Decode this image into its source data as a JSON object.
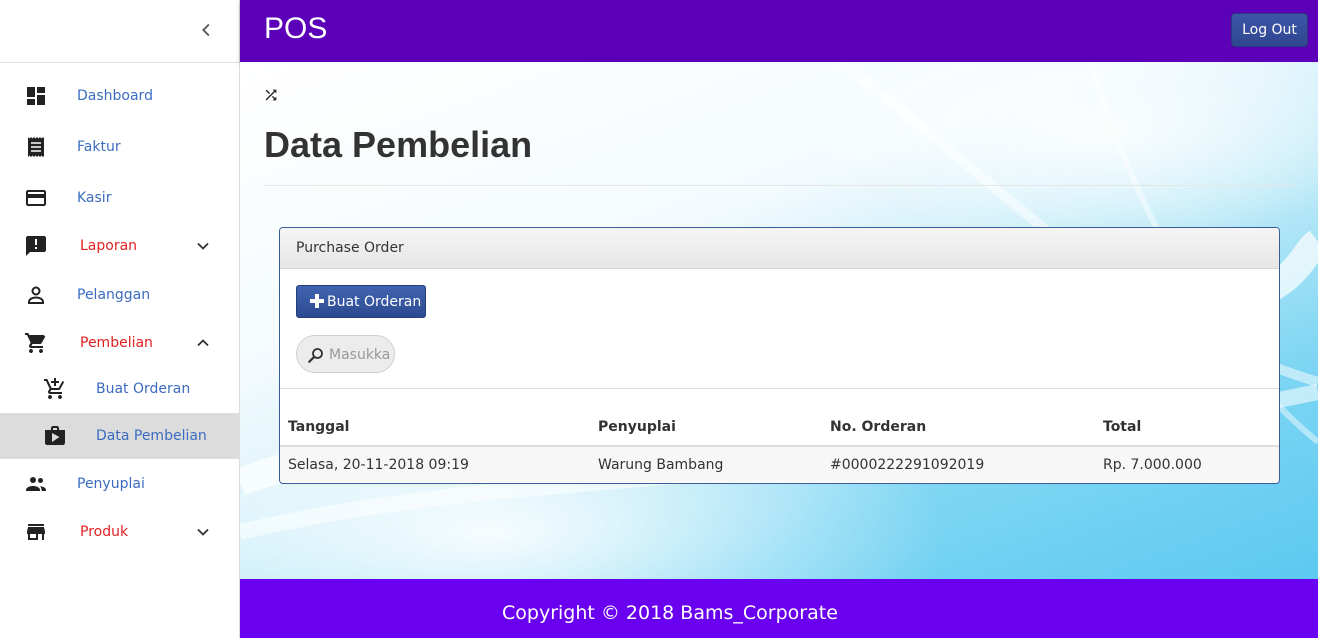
{
  "app": {
    "brand": "POS",
    "logout_label": "Log Out"
  },
  "sidebar": {
    "items": [
      {
        "label": "Dashboard",
        "icon": "dashboard-icon"
      },
      {
        "label": "Faktur",
        "icon": "receipt-icon"
      },
      {
        "label": "Kasir",
        "icon": "credit-card-icon"
      },
      {
        "label": "Laporan",
        "icon": "report-icon",
        "chevron": "expand"
      },
      {
        "label": "Pelanggan",
        "icon": "person-icon"
      },
      {
        "label": "Pembelian",
        "icon": "cart-icon",
        "chevron": "collapse"
      },
      {
        "label": "Buat Orderan",
        "icon": "add-cart-icon"
      },
      {
        "label": "Data Pembelian",
        "icon": "shop-icon",
        "active": true
      },
      {
        "label": "Penyuplai",
        "icon": "people-icon"
      },
      {
        "label": "Produk",
        "icon": "store-icon",
        "chevron": "expand"
      }
    ]
  },
  "page": {
    "title": "Data Pembelian"
  },
  "panel": {
    "heading": "Purchase Order",
    "create_button": "Buat Orderan",
    "search_placeholder": "Masukka"
  },
  "table": {
    "headers": [
      "Tanggal",
      "Penyuplai",
      "No. Orderan",
      "Total"
    ],
    "rows": [
      [
        "Selasa, 20-11-2018 09:19",
        "Warung Bambang",
        "#0000222291092019",
        "Rp. 7.000.000"
      ]
    ]
  },
  "footer": {
    "text": "Copyright © 2018 Bams_Corporate"
  },
  "colors": {
    "topbar": "#5b00b8",
    "footer": "#6a00f0",
    "link": "#3b6cc0",
    "alert": "#e02020",
    "button": "#2f4690"
  }
}
